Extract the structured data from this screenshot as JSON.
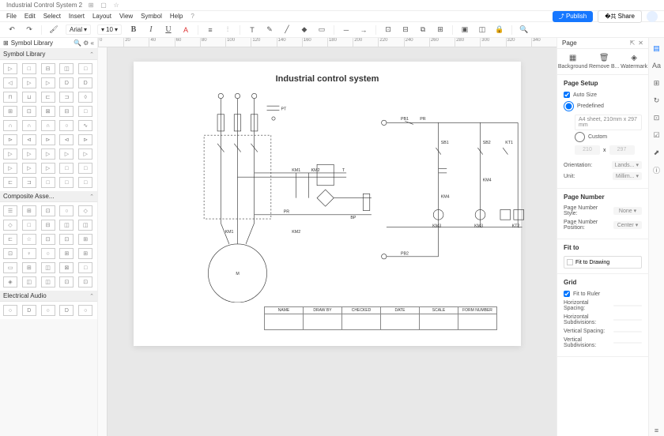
{
  "titlebar": {
    "title": "Industrial Control System 2"
  },
  "menu": {
    "items": [
      "File",
      "Edit",
      "Select",
      "Insert",
      "Layout",
      "View",
      "Symbol",
      "Help"
    ],
    "publish": "Publish",
    "share": "Share"
  },
  "fmt": {
    "font": "Arial",
    "size": "10"
  },
  "lib": {
    "header": "Symbol Library",
    "sec1": "Symbol Library",
    "sec2": "Composite Asse...",
    "sec3": "Electrical Audio"
  },
  "canvas": {
    "title": "Industrial control system",
    "labels": {
      "pt": "PT",
      "km1": "KM1",
      "km2": "KM2",
      "pb1": "PB1",
      "pb2": "PB2",
      "pr": "PR",
      "pr2": "PR",
      "sb1": "SB1",
      "sb2": "SB2",
      "kt1": "KT1",
      "kt2": "KT2",
      "km4": "KM4",
      "km3": "KM3",
      "km5": "KM3",
      "bp": "BP",
      "m": "M",
      "t": "T"
    },
    "table": [
      "NAME",
      "DRAW BY",
      "CHECKED",
      "DATE",
      "SCALE",
      "FORM NUMBER"
    ]
  },
  "page": {
    "header": "Page",
    "tabs": {
      "bg": "Background",
      "rm": "Remove B...",
      "wm": "Watermark"
    },
    "setup": {
      "title": "Page Setup",
      "auto": "Auto Size",
      "predef": "Predefined",
      "preset": "A4 sheet, 210mm x 297 mm",
      "custom": "Custom",
      "w": "210",
      "h": "297",
      "orient_l": "Orientation:",
      "orient_v": "Lands...",
      "unit_l": "Unit:",
      "unit_v": "Millim..."
    },
    "num": {
      "title": "Page Number",
      "style_l": "Page Number Style:",
      "style_v": "None",
      "pos_l": "Page Number Position:",
      "pos_v": "Center"
    },
    "fit": {
      "title": "Fit to",
      "btn": "Fit to Drawing"
    },
    "grid": {
      "title": "Grid",
      "ruler": "Fit to Ruler",
      "hs": "Horizontal Spacing:",
      "hsub": "Horizontal Subdivisions:",
      "vs": "Vertical Spacing:",
      "vsub": "Vertical Subdivisions:"
    }
  }
}
